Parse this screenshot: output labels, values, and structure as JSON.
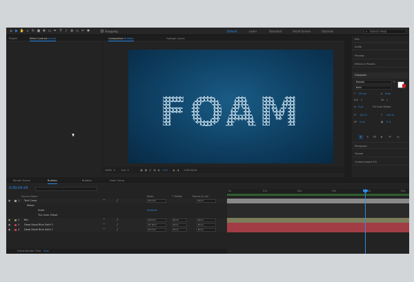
{
  "toolbar": {
    "tools": [
      "home-icon",
      "select-icon",
      "hand-icon",
      "zoom-icon",
      "rotate-icon",
      "camera-icon",
      "pan-icon",
      "mask-icon",
      "pen-icon",
      "type-icon",
      "brush-icon",
      "stamp-icon",
      "eraser-icon",
      "roto-icon",
      "puppet-icon"
    ],
    "tool_glyphs": [
      "⌂",
      "▶",
      "✋",
      "⌕",
      "↻",
      "▣",
      "✥",
      "▭",
      "✒",
      "T",
      "/",
      "⊕",
      "◇",
      "✂",
      "✱"
    ],
    "snapping_label": "Snapping",
    "workspaces": [
      "Default",
      "Learn",
      "Standard",
      "Small Screen",
      "Libraries"
    ],
    "search_placeholder": "Search Help"
  },
  "left_panel": {
    "tabs": [
      "Project",
      "Effect Controls",
      "(none)"
    ]
  },
  "comp_panel": {
    "tabs": [
      {
        "label": "Composition",
        "name": "Bubbles"
      },
      {
        "label": "Footage",
        "name": "(none)"
      }
    ],
    "title_text": "FOAM",
    "viewer_bar": {
      "zoom": "100%",
      "resolution": "Full",
      "exposure": "+0.0",
      "timecode": "0:00:04:24"
    }
  },
  "right_panel": {
    "sections": [
      "Info",
      "Audio",
      "Preview",
      "Effects & Presets"
    ],
    "character": {
      "title": "Character",
      "font_family": "Roboto",
      "font_style": "Bold",
      "font_size": "120 px",
      "leading": "Auto",
      "kerning": "0",
      "tracking": "0",
      "stroke_width": "0 px",
      "vert_scale": "100 %",
      "horiz_scale": "100 %",
      "baseline": "0 px",
      "tsume": "0 %",
      "stroke_mode": "Fill Over Stroke",
      "style_buttons": [
        "T",
        "T",
        "TT",
        "Tr",
        "T¹",
        "T₁"
      ]
    },
    "lower_sections": [
      "Paragraph",
      "Tracker",
      "Content-Aware Fill"
    ]
  },
  "timeline": {
    "tabs": [
      "Render Queue",
      "Bubbles",
      "Bubbles",
      "Foam Comp"
    ],
    "timecode": "0:00:04:24",
    "columns": [
      "Source Name",
      "Mode",
      "T TrkMat",
      "Parent & Link"
    ],
    "rows": [
      {
        "num": "1",
        "name": "Text Comp",
        "color": "#a0a0a0",
        "mode": "Normal",
        "trkmat": "",
        "parent": "None"
      },
      {
        "num": "",
        "name": "Masks",
        "color": "",
        "mode": "",
        "trkmat": "",
        "parent": ""
      },
      {
        "num": "",
        "name": "Scale",
        "color": "",
        "mode": "Subtract",
        "trkmat": "",
        "parent": ""
      },
      {
        "num": "",
        "name": "The Inner Offset",
        "color": "",
        "mode": "",
        "trkmat": "",
        "parent": ""
      },
      {
        "num": "2",
        "name": "Bbl",
        "color": "#8a8a60",
        "mode": "Normal",
        "trkmat": "None",
        "parent": "None"
      },
      {
        "num": "3",
        "name": "Deep Royal Blue Solid 3",
        "color": "#c0404a",
        "mode": "Ml. Burn",
        "trkmat": "None",
        "parent": "None"
      },
      {
        "num": "4",
        "name": "Deep Royal Blue Solid 1",
        "color": "#c0404a",
        "mode": "Normal",
        "trkmat": "None",
        "parent": "None"
      }
    ],
    "ruler_ticks": [
      "0s",
      "01s",
      "02s",
      "03s",
      "04s",
      "05s"
    ],
    "status": "Frame Render Time",
    "status_value": "0ms"
  }
}
